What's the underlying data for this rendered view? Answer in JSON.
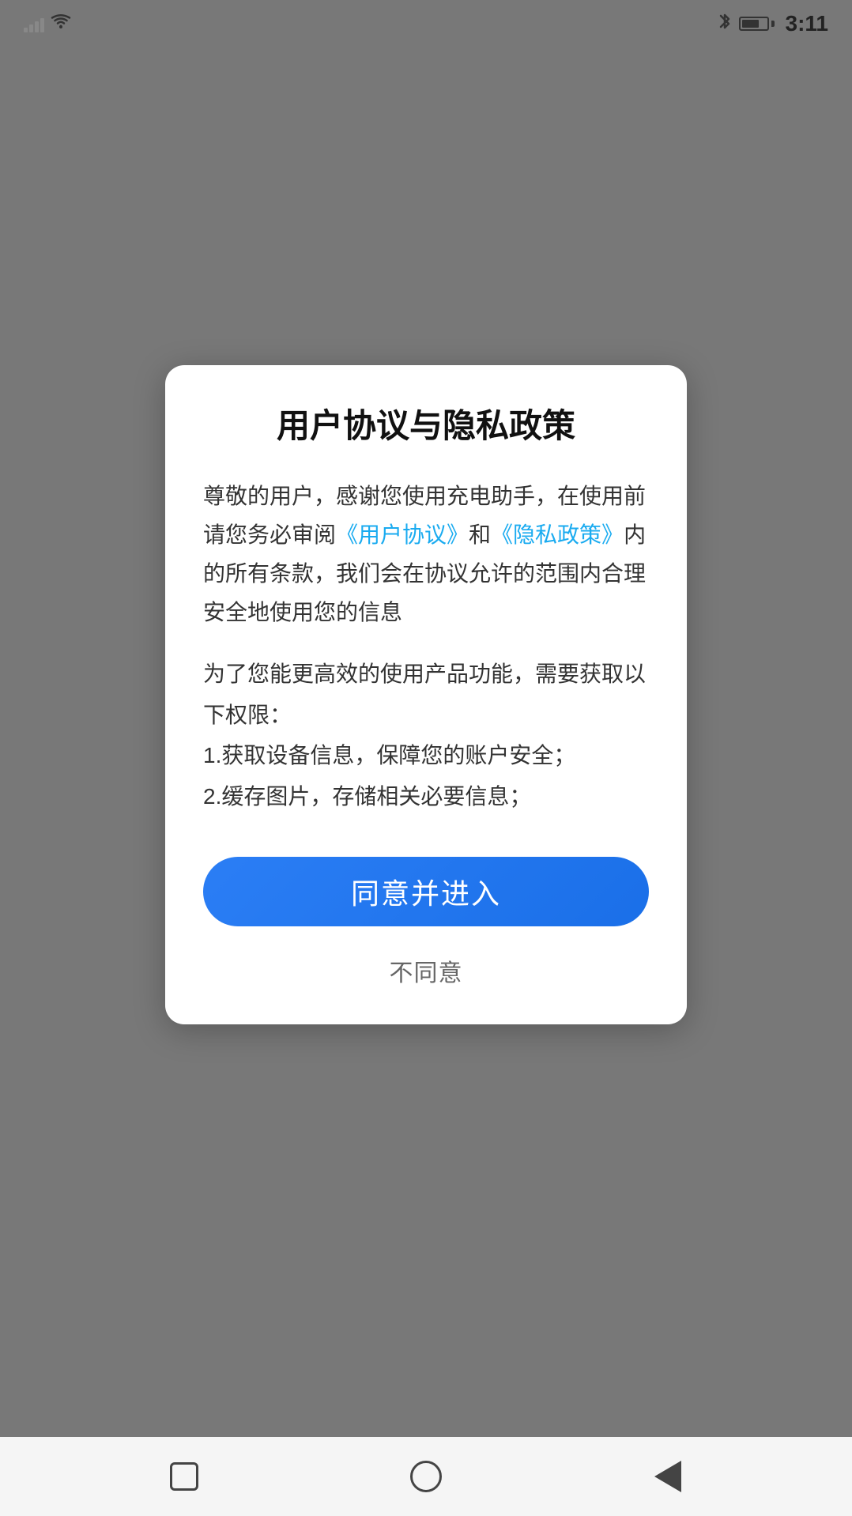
{
  "statusBar": {
    "time": "3:11",
    "bluetoothLabel": "BT",
    "batteryLevel": 70
  },
  "dialog": {
    "title": "用户协议与隐私政策",
    "bodyText1": "尊敬的用户，感谢您使用充电助手，在使用前请您务必审阅",
    "linkUserAgreement": "《用户协议》",
    "bodyText2": "和",
    "linkPrivacyPolicy": "《隐私政策》",
    "bodyText3": "内的所有条款，我们会在协议允许的范围内合理安全地使用您的信息",
    "permissionsIntro": "为了您能更高效的使用产品功能，需要获取以下权限：",
    "permission1": "1.获取设备信息，保障您的账户安全；",
    "permission2": "2.缓存图片，存储相关必要信息；",
    "agreeButton": "同意并进入",
    "disagreeButton": "不同意"
  },
  "navBar": {
    "squareLabel": "home",
    "circleLabel": "back",
    "triangleLabel": "recent"
  },
  "colors": {
    "accent": "#2B7EF5",
    "linkColor": "#1AABF0",
    "background": "#787878",
    "dialogBg": "#ffffff",
    "textPrimary": "#111111",
    "textBody": "#333333",
    "textSecondary": "#666666"
  }
}
